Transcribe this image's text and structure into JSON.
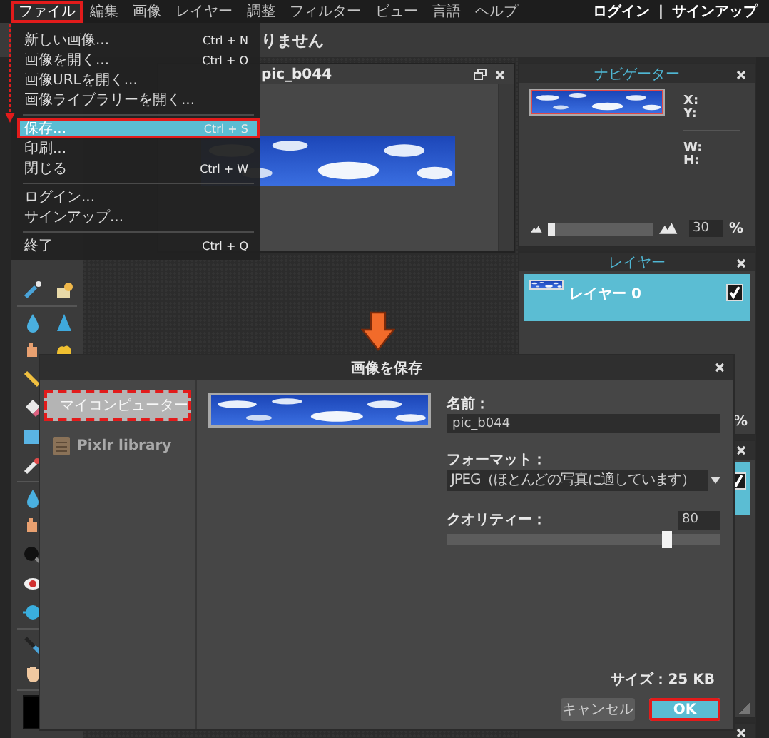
{
  "menubar": {
    "items": [
      {
        "label": "ファイル",
        "selected": true,
        "callout": true
      },
      {
        "label": "編集",
        "selected": false,
        "callout": false
      },
      {
        "label": "画像",
        "selected": false,
        "callout": false
      },
      {
        "label": "レイヤー",
        "selected": false,
        "callout": false
      },
      {
        "label": "調整",
        "selected": false,
        "callout": false
      },
      {
        "label": "フィルター",
        "selected": false,
        "callout": false
      },
      {
        "label": "ビュー",
        "selected": false,
        "callout": false
      },
      {
        "label": "言語",
        "selected": false,
        "callout": false
      },
      {
        "label": "ヘルプ",
        "selected": false,
        "callout": false
      }
    ],
    "account": {
      "login": "ログイン",
      "divider": "|",
      "signup": "サインアップ"
    }
  },
  "options_bar": {
    "text": "りません"
  },
  "document": {
    "title": "pic_b044"
  },
  "navigator": {
    "title": "ナビゲーター",
    "coords": [
      "X:",
      "Y:"
    ],
    "size": [
      "W:",
      "H:"
    ],
    "zoom": {
      "level": 0.05,
      "value": "30",
      "unit": "%"
    }
  },
  "layers": {
    "title": "レイヤー",
    "items": [
      {
        "name": "レイヤー 0",
        "selected": true,
        "visible": true
      }
    ],
    "opacity_unit": "%"
  },
  "panel_3": {
    "rows": [
      {
        "selected": true,
        "checked": true
      }
    ]
  },
  "file_menu": {
    "items": [
      {
        "kind": "item",
        "label": "新しい画像...",
        "shortcut": "Ctrl + N",
        "selected": false,
        "callout": false
      },
      {
        "kind": "item",
        "label": "画像を開く...",
        "shortcut": "Ctrl + O",
        "selected": false,
        "callout": false
      },
      {
        "kind": "item",
        "label": "画像URLを開く...",
        "selected": false,
        "callout": false
      },
      {
        "kind": "item",
        "label": "画像ライブラリーを開く...",
        "selected": false,
        "callout": false
      },
      {
        "kind": "separator"
      },
      {
        "kind": "item",
        "label": "保存...",
        "shortcut": "Ctrl + S",
        "selected": true,
        "callout": true
      },
      {
        "kind": "item",
        "label": "印刷...",
        "selected": false,
        "callout": false
      },
      {
        "kind": "item",
        "label": "閉じる",
        "shortcut": "Ctrl + W",
        "selected": false,
        "callout": false
      },
      {
        "kind": "separator"
      },
      {
        "kind": "item",
        "label": "ログイン...",
        "selected": false,
        "callout": false
      },
      {
        "kind": "item",
        "label": "サインアップ...",
        "selected": false,
        "callout": false
      },
      {
        "kind": "separator"
      },
      {
        "kind": "item",
        "label": "終了",
        "shortcut": "Ctrl + Q",
        "selected": false,
        "callout": false
      }
    ]
  },
  "dialog": {
    "title": "画像を保存",
    "locations": [
      {
        "kind": "computer",
        "label": "マイコンピューター",
        "selected": true,
        "callout": true
      },
      {
        "kind": "library",
        "label": "Pixlr library",
        "selected": false,
        "callout": false
      }
    ],
    "name_label": "名前：",
    "name_value": "pic_b044",
    "format_label": "フォーマット：",
    "format_value": "JPEG（ほとんどの写真に適しています）",
    "quality": {
      "label": "クオリティー：",
      "value": "80",
      "level": 0.8
    },
    "size_text": "サイズ：25 KB",
    "buttons": [
      {
        "label": "キャンセル",
        "kind": "secondary",
        "callout": false
      },
      {
        "label": "OK",
        "kind": "primary",
        "callout": true
      }
    ]
  }
}
